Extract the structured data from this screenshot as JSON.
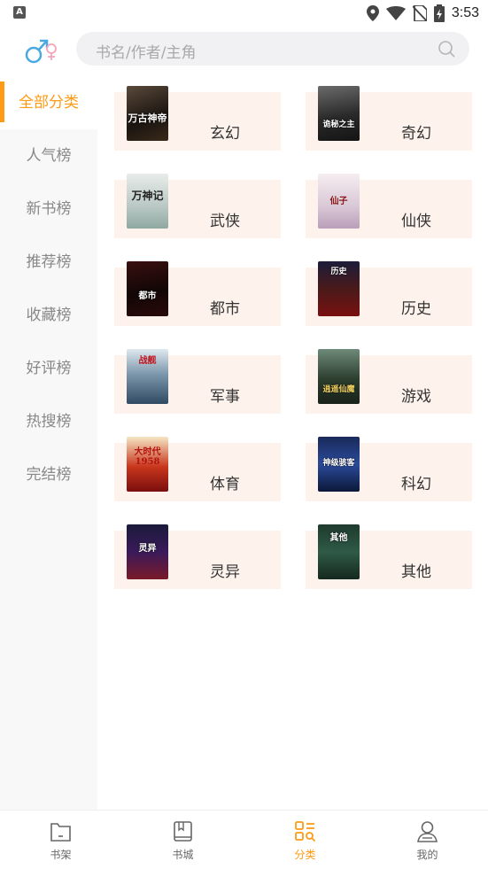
{
  "status_bar": {
    "time": "3:53",
    "app_icon_letter": "A"
  },
  "header": {
    "search_placeholder": "书名/作者/主角"
  },
  "sidebar": {
    "items": [
      {
        "label": "全部分类",
        "active": true
      },
      {
        "label": "人气榜",
        "active": false
      },
      {
        "label": "新书榜",
        "active": false
      },
      {
        "label": "推荐榜",
        "active": false
      },
      {
        "label": "收藏榜",
        "active": false
      },
      {
        "label": "好评榜",
        "active": false
      },
      {
        "label": "热搜榜",
        "active": false
      },
      {
        "label": "完结榜",
        "active": false
      }
    ]
  },
  "categories": [
    {
      "label": "玄幻",
      "cover_text": "万古神帝"
    },
    {
      "label": "奇幻",
      "cover_text": "诡秘之主"
    },
    {
      "label": "武侠",
      "cover_text": "万神记"
    },
    {
      "label": "仙侠",
      "cover_text": "仙子"
    },
    {
      "label": "都市",
      "cover_text": "都市"
    },
    {
      "label": "历史",
      "cover_text": "历史"
    },
    {
      "label": "军事",
      "cover_text": "战舰"
    },
    {
      "label": "游戏",
      "cover_text": "逍遥仙魔"
    },
    {
      "label": "体育",
      "cover_text": "大时代1958"
    },
    {
      "label": "科幻",
      "cover_text": "神级骇客"
    },
    {
      "label": "灵异",
      "cover_text": "灵异"
    },
    {
      "label": "其他",
      "cover_text": "其他"
    }
  ],
  "bottom_nav": {
    "items": [
      {
        "label": "书架",
        "icon": "bookshelf-icon",
        "active": false
      },
      {
        "label": "书城",
        "icon": "book-icon",
        "active": false
      },
      {
        "label": "分类",
        "icon": "category-icon",
        "active": true
      },
      {
        "label": "我的",
        "icon": "user-icon",
        "active": false
      }
    ]
  },
  "colors": {
    "accent": "#ff9a14",
    "card_bg": "#fdf2ec",
    "sidebar_bg": "#f8f8f8"
  }
}
